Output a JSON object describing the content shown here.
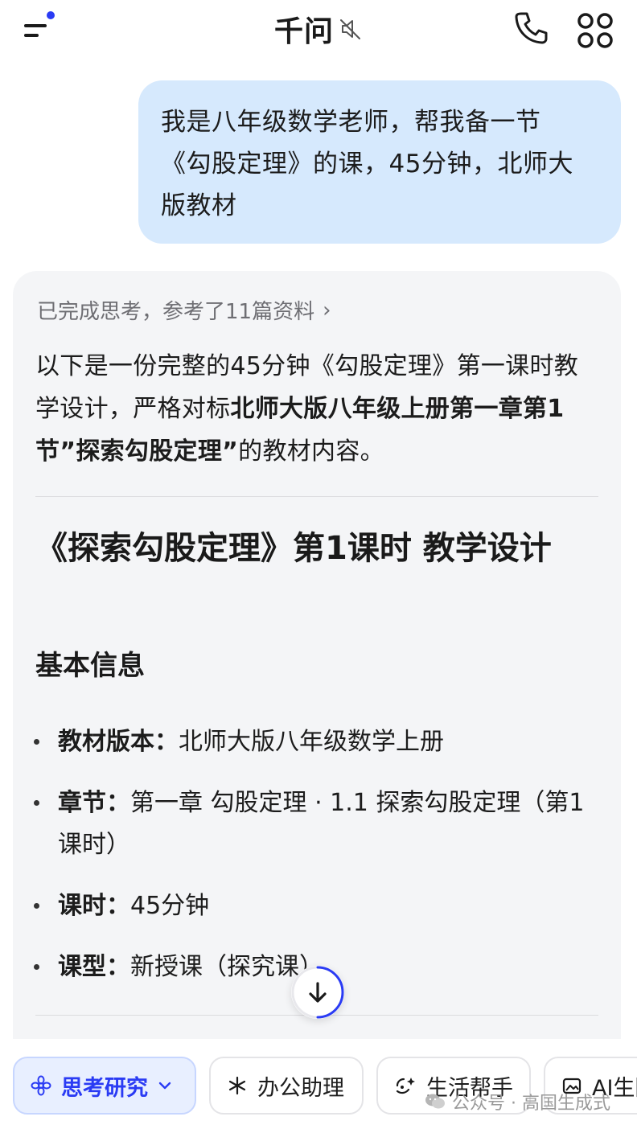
{
  "header": {
    "title": "千问",
    "menu_icon": "menu-icon",
    "mute_icon": "speaker-muted-icon",
    "phone_icon": "phone-icon",
    "apps_icon": "apps-grid-icon",
    "accent_color": "#2a3bf4"
  },
  "user_message": {
    "text": "我是八年级数学老师，帮我备一节《勾股定理》的课，45分钟，北师大版教材",
    "line1": "我是八年级数学老师，帮我备一节",
    "line2": "《勾股定理》的课，45分钟，北师大",
    "line3": "版教材",
    "bubble_color": "#d6e9fd"
  },
  "answer": {
    "thinking_status": "已完成思考，参考了11篇资料",
    "intro_part1": "以下是一份完整的45分钟《勾股定理》第一课时教学设计，严格对标",
    "intro_bold": "北师大版八年级上册第一章第1节",
    "intro_quote": "”探索勾股定理”",
    "intro_part2": "的教材内容。",
    "heading": "《探索勾股定理》第1课时 教学设计",
    "section_title": "基本信息",
    "info": [
      {
        "label": "教材版本",
        "value": "北师大版八年级数学上册"
      },
      {
        "label": "章节",
        "value": "第一章 勾股定理 · 1.1 探索勾股定理（第1课时）"
      },
      {
        "label": "课时",
        "value": "45分钟"
      },
      {
        "label": "课型",
        "value": "新授课（探究课）"
      }
    ]
  },
  "scroll_button": {
    "icon": "arrow-down-icon"
  },
  "chips": [
    {
      "label": "思考研究",
      "icon": "flower-icon",
      "active": true,
      "has_dropdown": true
    },
    {
      "label": "办公助理",
      "icon": "sparkle-icon",
      "active": false
    },
    {
      "label": "生活帮手",
      "icon": "chat-sparkle-icon",
      "active": false
    },
    {
      "label": "AI生图",
      "icon": "image-icon",
      "active": false
    }
  ],
  "watermark": {
    "text": "公众号 · 高国生成式",
    "icon": "wechat-icon"
  }
}
